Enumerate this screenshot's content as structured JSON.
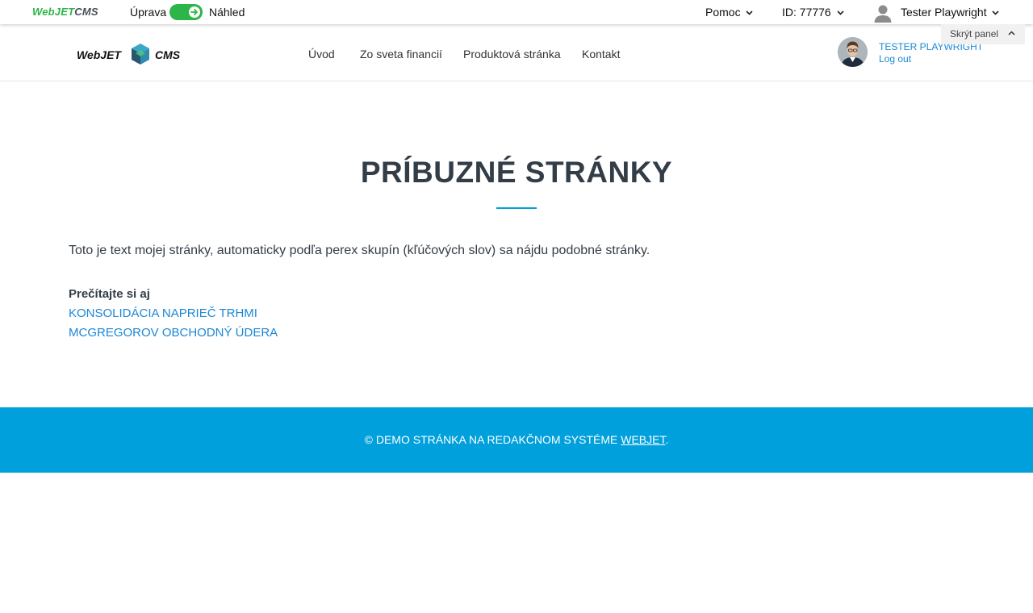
{
  "admin_bar": {
    "logo_part1": "WebJET",
    "logo_part2": "CMS",
    "mode_edit_label": "Úprava",
    "mode_view_label": "Náhled",
    "help_label": "Pomoc",
    "id_label": "ID: 77776",
    "user_label": "Tester Playwright",
    "hide_panel_label": "Skrýt panel",
    "accent_color": "#2db54a"
  },
  "site_header": {
    "logo_word1": "WebJET",
    "logo_word2": "CMS",
    "nav": [
      "Úvod",
      "Zo sveta financií",
      "Produktová stránka",
      "Kontakt"
    ],
    "user_name": "TESTER PLAYWRIGHT",
    "logout_label": "Log out",
    "link_color": "#1b87d6"
  },
  "content": {
    "title": "PRÍBUZNÉ STRÁNKY",
    "intro": "Toto je text mojej stránky, automaticky podľa perex skupín (kľúčových slov) sa nájdu podobné stránky.",
    "related_heading": "Prečítajte si aj",
    "related_links": [
      "KONSOLIDÁCIA NAPRIEČ TRHMI",
      "MCGREGOROV OBCHODNÝ ÚDERA"
    ],
    "accent_color": "#00a0dc"
  },
  "footer": {
    "text_before": "© DEMO STRÁNKA NA REDAKČNOM SYSTÉME ",
    "link_text": "WEBJET",
    "text_after": ".",
    "background": "#00a0dc"
  }
}
